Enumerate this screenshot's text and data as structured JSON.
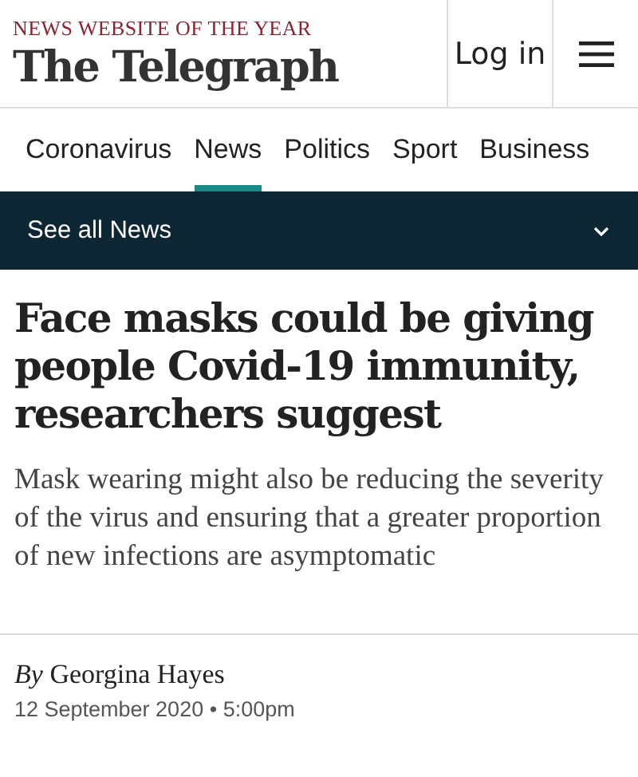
{
  "header": {
    "tagline": "NEWS WEBSITE OF THE YEAR",
    "logo": "The Telegraph",
    "login": "Log in"
  },
  "tabs": [
    {
      "label": "Coronavirus",
      "selected": false
    },
    {
      "label": "News",
      "selected": true
    },
    {
      "label": "Politics",
      "selected": false
    },
    {
      "label": "Sport",
      "selected": false
    },
    {
      "label": "Business",
      "selected": false
    }
  ],
  "section_bar": {
    "label": "See all News",
    "expanded": false
  },
  "article": {
    "headline": "Face masks could be giving people Covid-19 immunity, researchers suggest",
    "standfirst": "Mask wearing might also be reducing the severity of the virus and ensuring that a greater proportion of new infections are asymptomatic",
    "byline": "*By* Georgina Hayes",
    "date": "12 September 2020 • 5:00pm"
  }
}
